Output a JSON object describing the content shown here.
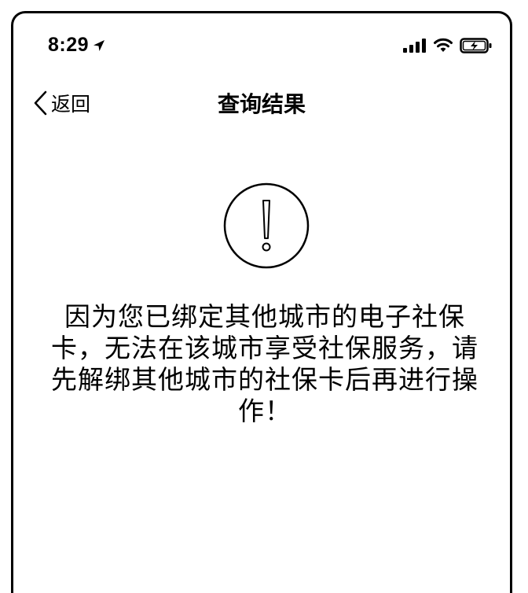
{
  "status_bar": {
    "time": "8:29",
    "location_icon": "location-arrow-icon",
    "signal_icon": "cellular-signal-icon",
    "wifi_icon": "wifi-icon",
    "battery_icon": "battery-charging-icon"
  },
  "nav": {
    "back_label": "返回",
    "back_icon": "chevron-left-icon",
    "title": "查询结果"
  },
  "alert": {
    "icon": "exclamation-circle-icon",
    "message": "因为您已绑定其他城市的电子社保卡，无法在该城市享受社保服务，请先解绑其他城市的社保卡后再进行操作！"
  }
}
